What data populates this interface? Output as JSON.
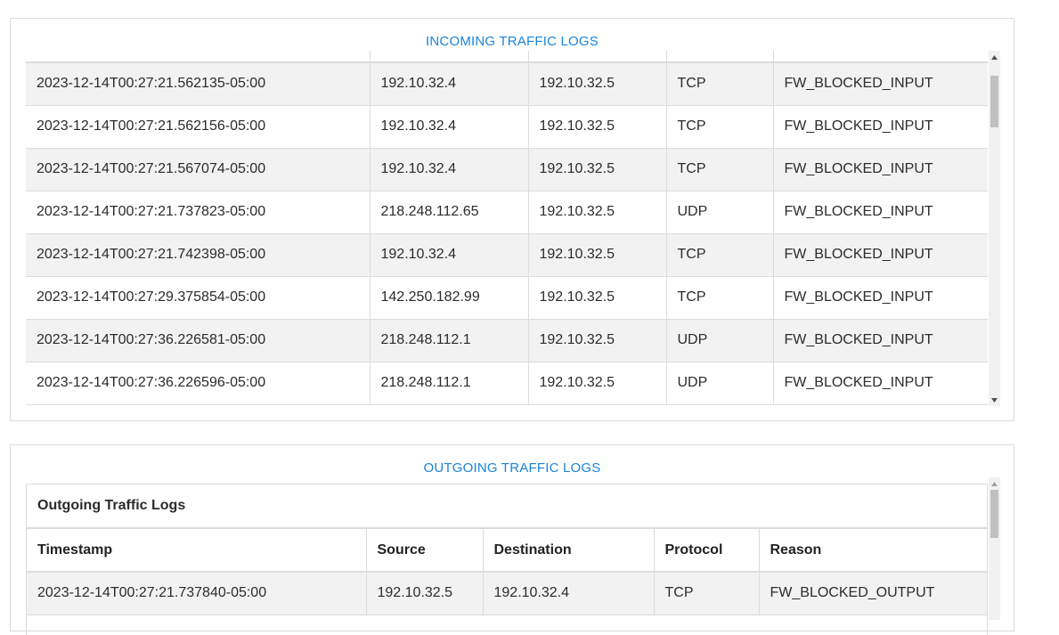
{
  "incoming": {
    "title": "INCOMING TRAFFIC LOGS",
    "rows": [
      {
        "timestamp": "2023-12-14T00:27:21.562135-05:00",
        "source": "192.10.32.4",
        "destination": "192.10.32.5",
        "protocol": "TCP",
        "reason": "FW_BLOCKED_INPUT"
      },
      {
        "timestamp": "2023-12-14T00:27:21.562156-05:00",
        "source": "192.10.32.4",
        "destination": "192.10.32.5",
        "protocol": "TCP",
        "reason": "FW_BLOCKED_INPUT"
      },
      {
        "timestamp": "2023-12-14T00:27:21.567074-05:00",
        "source": "192.10.32.4",
        "destination": "192.10.32.5",
        "protocol": "TCP",
        "reason": "FW_BLOCKED_INPUT"
      },
      {
        "timestamp": "2023-12-14T00:27:21.737823-05:00",
        "source": "218.248.112.65",
        "destination": "192.10.32.5",
        "protocol": "UDP",
        "reason": "FW_BLOCKED_INPUT"
      },
      {
        "timestamp": "2023-12-14T00:27:21.742398-05:00",
        "source": "192.10.32.4",
        "destination": "192.10.32.5",
        "protocol": "TCP",
        "reason": "FW_BLOCKED_INPUT"
      },
      {
        "timestamp": "2023-12-14T00:27:29.375854-05:00",
        "source": "142.250.182.99",
        "destination": "192.10.32.5",
        "protocol": "TCP",
        "reason": "FW_BLOCKED_INPUT"
      },
      {
        "timestamp": "2023-12-14T00:27:36.226581-05:00",
        "source": "218.248.112.1",
        "destination": "192.10.32.5",
        "protocol": "UDP",
        "reason": "FW_BLOCKED_INPUT"
      },
      {
        "timestamp": "2023-12-14T00:27:36.226596-05:00",
        "source": "218.248.112.1",
        "destination": "192.10.32.5",
        "protocol": "UDP",
        "reason": "FW_BLOCKED_INPUT"
      }
    ]
  },
  "outgoing": {
    "title": "OUTGOING TRAFFIC LOGS",
    "caption": "Outgoing Traffic Logs",
    "columns": [
      "Timestamp",
      "Source",
      "Destination",
      "Protocol",
      "Reason"
    ],
    "rows": [
      {
        "timestamp": "2023-12-14T00:27:21.737840-05:00",
        "source": "192.10.32.5",
        "destination": "192.10.32.4",
        "protocol": "TCP",
        "reason": "FW_BLOCKED_OUTPUT"
      }
    ]
  },
  "colors": {
    "title": "#1b84d8",
    "row_alt": "#f2f2f2",
    "border": "#dcdcdc",
    "scrollbar_thumb": "#c1c1c1"
  },
  "icons": [
    "scroll-up-arrow-icon",
    "scroll-down-arrow-icon"
  ]
}
